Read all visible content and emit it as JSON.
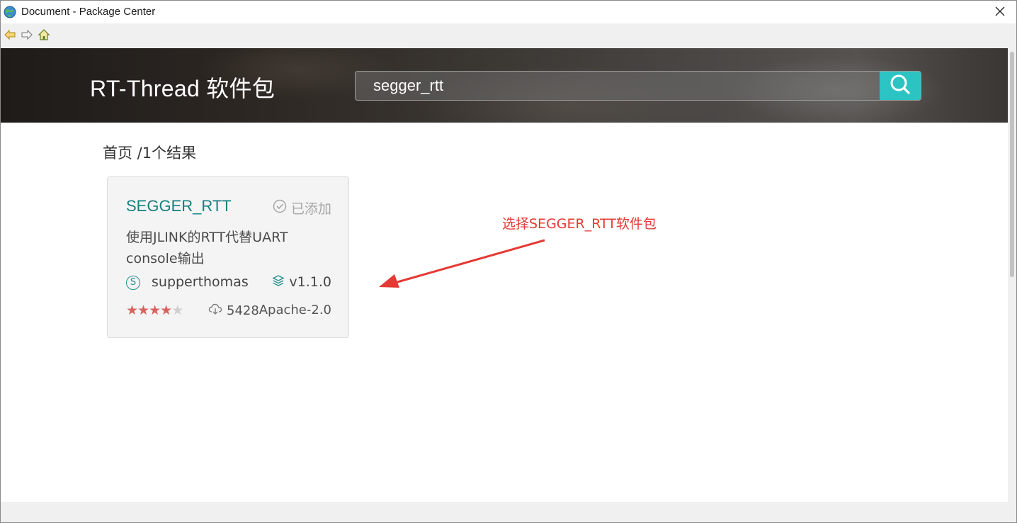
{
  "window": {
    "title": "Document - Package Center"
  },
  "toolbar": {
    "back_icon": "back-arrow-icon",
    "forward_icon": "forward-arrow-icon",
    "home_icon": "home-icon"
  },
  "header": {
    "title": "RT-Thread 软件包",
    "search_value": "segger_rtt",
    "accent_color": "#2cc3c3"
  },
  "breadcrumb": {
    "text": "首页 /1个结果"
  },
  "results": [
    {
      "name": "SEGGER_RTT",
      "status": "已添加",
      "description": "使用JLINK的RTT代替UART console输出",
      "author_initial": "S",
      "author": "supperthomas",
      "version": "v1.1.0",
      "rating": 4.5,
      "downloads": "5428",
      "license": "Apache-2.0"
    }
  ],
  "annotation": {
    "text": "选择SEGGER_RTT软件包",
    "color": "#e53935"
  }
}
